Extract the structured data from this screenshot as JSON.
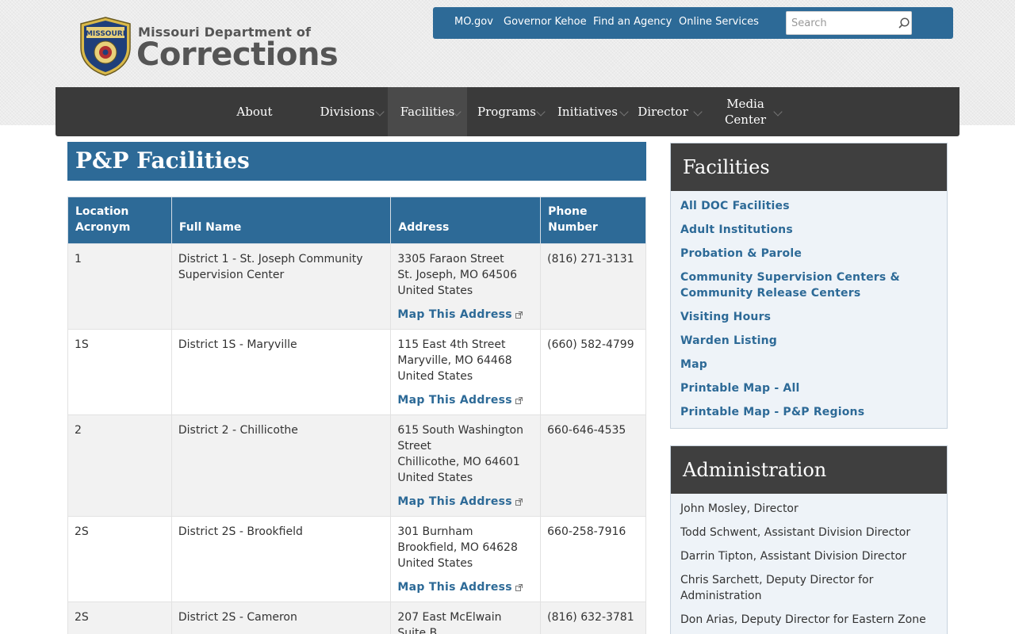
{
  "header": {
    "logo_line1": "Missouri Department of",
    "logo_line2": "Corrections",
    "seal_top_text": "MISSOURI"
  },
  "utility_nav": {
    "links": [
      "MO.gov",
      "Governor Kehoe",
      "Find an Agency",
      "Online Services"
    ],
    "search_placeholder": "Search"
  },
  "main_nav": {
    "items": [
      {
        "label": "About",
        "has_dropdown": false
      },
      {
        "label": "Divisions",
        "has_dropdown": true
      },
      {
        "label": "Facilities",
        "has_dropdown": true,
        "active": true
      },
      {
        "label": "Programs",
        "has_dropdown": true
      },
      {
        "label": "Initiatives",
        "has_dropdown": true
      },
      {
        "label": "Director",
        "has_dropdown": true
      },
      {
        "label": "Media Center",
        "has_dropdown": true
      }
    ]
  },
  "page": {
    "title": "P&P Facilities"
  },
  "table": {
    "headers": [
      "Location Acronym",
      "Full Name",
      "Address",
      "Phone Number"
    ],
    "map_link_label": "Map This Address",
    "rows": [
      {
        "acronym": "1",
        "name": "District 1 - St. Joseph Community Supervision Center",
        "address": [
          "3305 Faraon Street",
          "St. Joseph, MO 64506",
          "United States"
        ],
        "phone": "(816) 271-3131"
      },
      {
        "acronym": "1S",
        "name": "District 1S - Maryville",
        "address": [
          "115 East 4th Street",
          "Maryville, MO 64468",
          "United States"
        ],
        "phone": "(660) 582-4799"
      },
      {
        "acronym": "2",
        "name": "District 2 - Chillicothe",
        "address": [
          "615 South Washington Street",
          "Chillicothe, MO 64601",
          "United States"
        ],
        "phone": "660-646-4535"
      },
      {
        "acronym": "2S",
        "name": "District 2S - Brookfield",
        "address": [
          "301 Burnham",
          "Brookfield, MO 64628",
          "United States"
        ],
        "phone": "660-258-7916"
      },
      {
        "acronym": "2S",
        "name": "District 2S - Cameron",
        "address": [
          "207 East McElwain",
          "Suite B"
        ],
        "phone": "(816) 632-3781"
      }
    ]
  },
  "sidebar": {
    "facilities": {
      "title": "Facilities",
      "links": [
        "All DOC Facilities",
        "Adult Institutions",
        "Probation & Parole",
        "Community Supervision Centers & Community Release Centers",
        "Visiting Hours",
        "Warden Listing",
        "Map",
        "Printable Map - All",
        "Printable Map - P&P Regions"
      ]
    },
    "administration": {
      "title": "Administration",
      "items": [
        "John Mosley, Director",
        "Todd Schwent, Assistant Division Director",
        "Darrin Tipton, Assistant Division Director",
        "Chris Sarchett, Deputy Director for Administration",
        "Don Arias, Deputy Director for Eastern Zone"
      ]
    }
  },
  "colors": {
    "brand_blue": "#2d6a97",
    "nav_dark": "#3a3a3a",
    "sidebar_head": "#3f3f3f"
  },
  "icons": [
    "seal-logo",
    "search-icon",
    "chevron-down-icon",
    "external-link-icon"
  ]
}
